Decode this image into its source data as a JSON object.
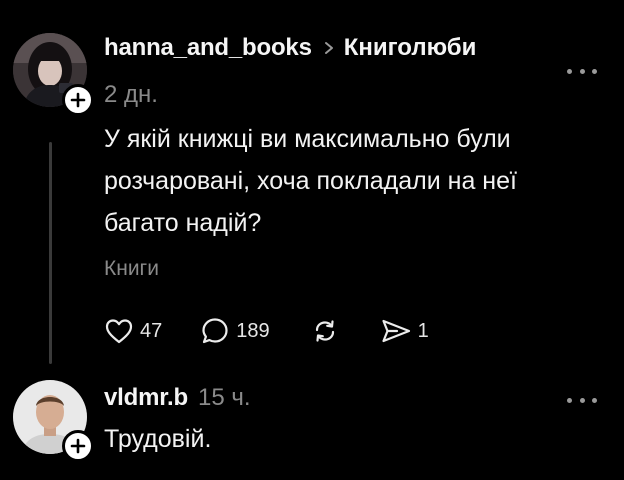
{
  "post": {
    "username": "hanna_and_books",
    "community": "Книголюби",
    "time": "2 дн.",
    "text_lines": [
      "У якій книжці ви максимально були",
      "розчаровані, хоча покладали на неї",
      "багато надій?"
    ],
    "tag": "Книги",
    "actions": {
      "likes": "47",
      "comments": "189",
      "shares": "1"
    }
  },
  "reply": {
    "username": "vldmr.b",
    "time": "15 ч.",
    "text": "Трудовій."
  },
  "colors": {
    "background": "#000000",
    "text": "#f3f3f3",
    "muted": "#8a8a8a",
    "thread_line": "#3a3a3a"
  },
  "icons": [
    "chevron-right-icon",
    "more-icon",
    "plus-icon",
    "heart-icon",
    "comment-icon",
    "repost-icon",
    "share-icon"
  ]
}
